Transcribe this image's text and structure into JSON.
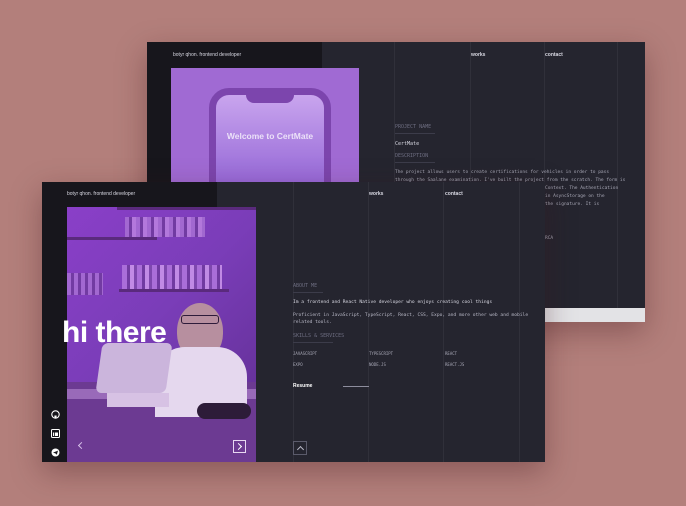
{
  "back": {
    "brand": "botyr qhon. frontend developer",
    "nav": {
      "works": "works",
      "contact": "contact"
    },
    "phone_text": "Welcome to CertMate",
    "project_name_label": "PROJECT NAME",
    "project_name": "CertMate",
    "description_label": "DESCRIPTION",
    "description_lines": [
      "The project allows users to create certifications for vehicles in order to pass",
      "through the Saalane examination. I've built the project from the scratch. The form is",
      "",
      ""
    ],
    "tail_fragments": [
      "Context. The Authentication",
      "in AsyncStorage on the",
      "the signature. It is",
      "",
      "RCA"
    ],
    "bottom_bar_color": "#e3e3e6"
  },
  "front": {
    "brand": "botyr qhon. frontend developer",
    "nav": {
      "works": "works",
      "contact": "contact"
    },
    "hero_text": "hi there",
    "about_label": "ABOUT ME",
    "about_line1": "Im a frontend and React Native developer who enjoys creating cool things",
    "about_line2a": "Proficient in JavaScript, TypeScript, React, CSS, Expo, and more other web and mobile",
    "about_line2b": "related tools.",
    "skills_label": "SKILLS & SERVICES",
    "skills": [
      "JAVASCRIPT",
      "TYPESCRIPT",
      "REACT",
      "EXPO",
      "NODE.JS",
      "REACT.JS"
    ],
    "resume_label": "Resume",
    "social_icons": [
      "github-icon",
      "linkedin-icon",
      "telegram-icon"
    ],
    "accent_color": "#9b55d4"
  }
}
